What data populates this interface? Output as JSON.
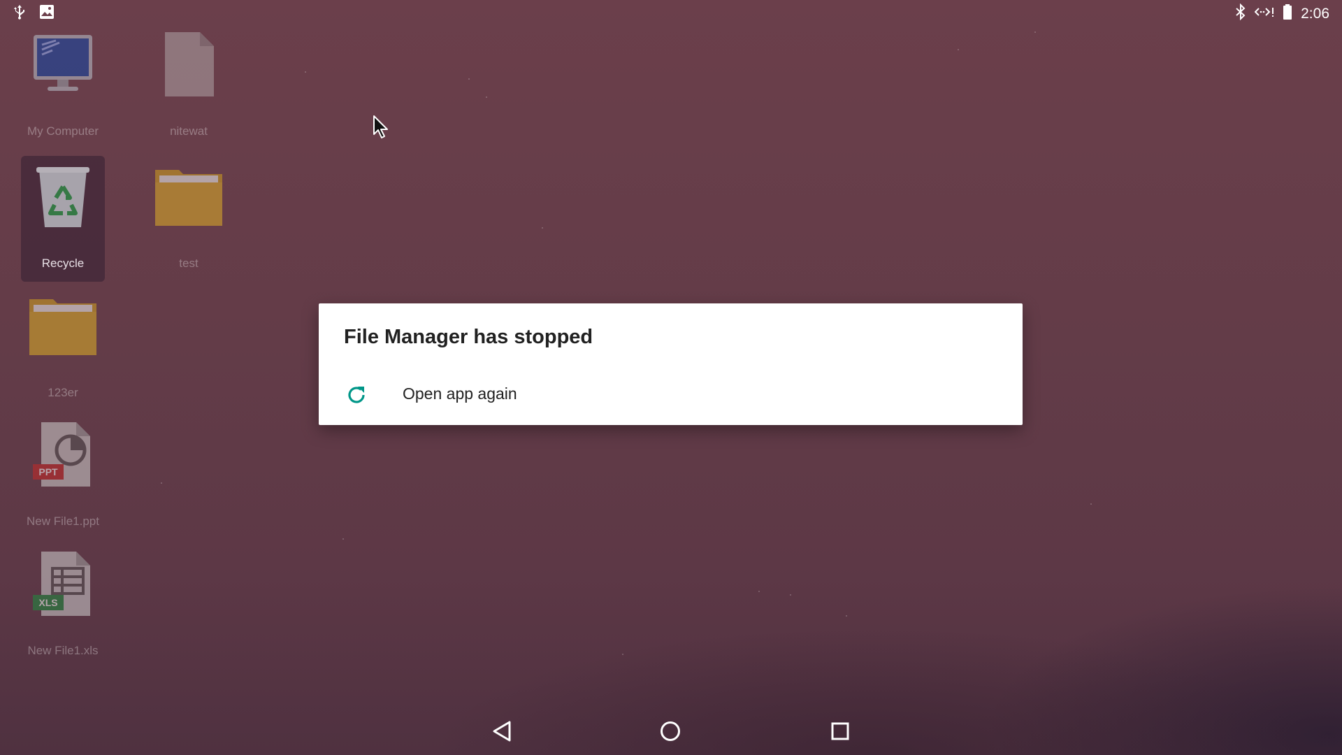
{
  "status_bar": {
    "left_icons": [
      "usb-icon",
      "image-icon"
    ],
    "right_icons": [
      "bluetooth-icon",
      "signal-icon",
      "battery-icon"
    ],
    "time": "2:06"
  },
  "desktop": {
    "items": [
      {
        "label": "My Computer",
        "icon": "computer-icon",
        "selected": false
      },
      {
        "label": "nitewat",
        "icon": "file-icon",
        "selected": false
      },
      {
        "label": "Recycle",
        "icon": "recycle-bin-icon",
        "selected": true
      },
      {
        "label": "test",
        "icon": "folder-icon",
        "selected": false
      },
      {
        "label": "123er",
        "icon": "folder-icon",
        "selected": false
      },
      {
        "label": "New File1.ppt",
        "icon": "ppt-file-icon",
        "badge": "PPT",
        "selected": false
      },
      {
        "label": "New File1.xls",
        "icon": "xls-file-icon",
        "badge": "XLS",
        "selected": false
      }
    ]
  },
  "dialog": {
    "title": "File Manager has stopped",
    "action_label": "Open app again",
    "action_icon": "refresh-icon",
    "accent_color": "#009688"
  },
  "nav_bar": {
    "buttons": [
      "back-icon",
      "home-icon",
      "recents-icon"
    ]
  },
  "colors": {
    "ppt_badge": "#c62828",
    "xls_badge": "#1e8e3e",
    "folder": "#d4a52a"
  }
}
